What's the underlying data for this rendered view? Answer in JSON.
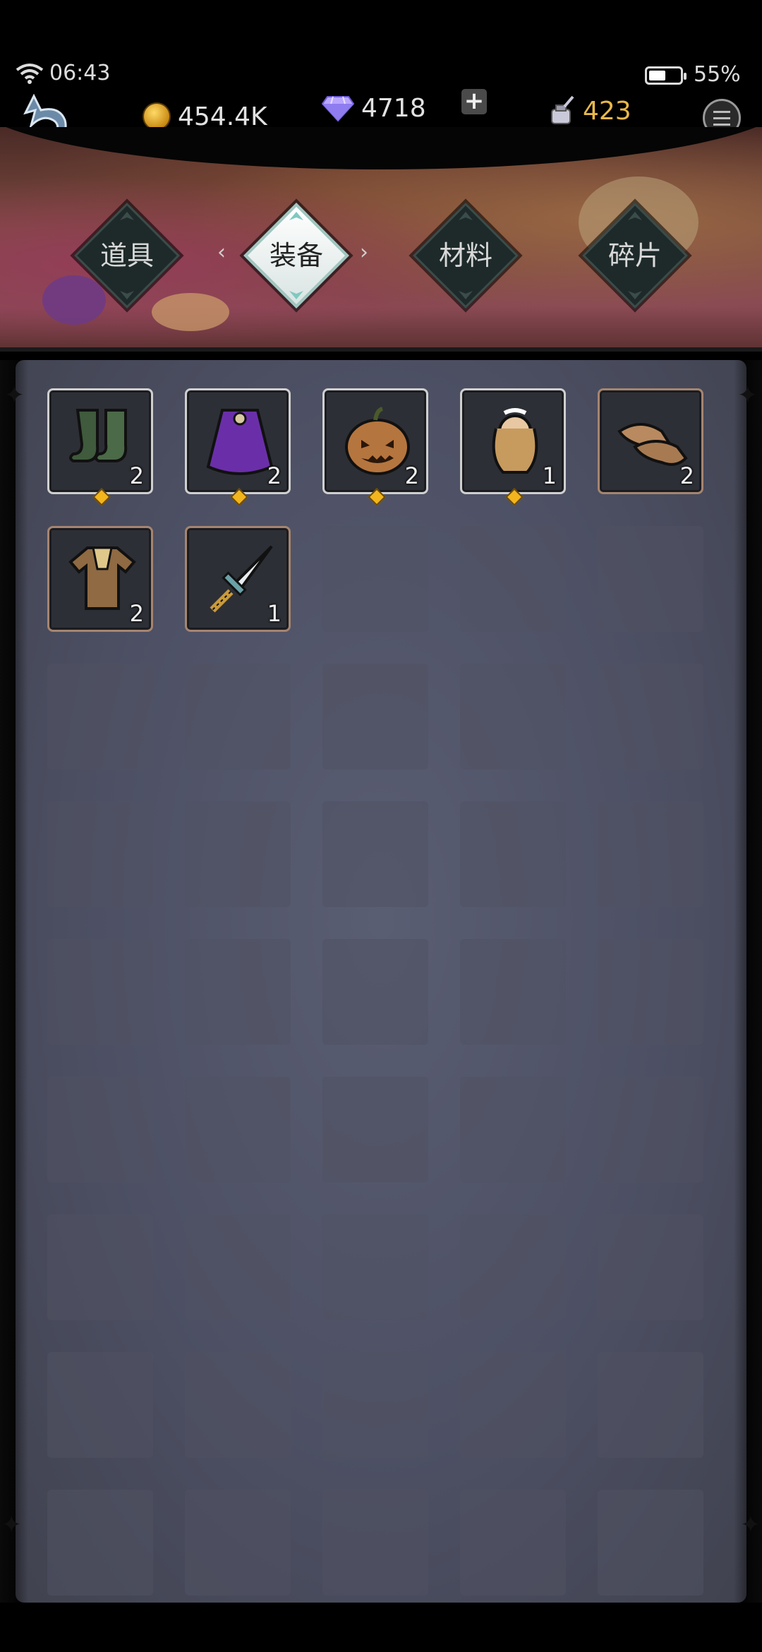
{
  "status_bar": {
    "time": "06:43",
    "battery_percent": "55%",
    "battery_level": 0.55
  },
  "currencies": {
    "gold": "454.4K",
    "diamond": "4718",
    "add_symbol": "+",
    "ink": "423"
  },
  "tabs": [
    {
      "label": "道具",
      "active": false
    },
    {
      "label": "装备",
      "active": true
    },
    {
      "label": "材料",
      "active": false
    },
    {
      "label": "碎片",
      "active": false
    }
  ],
  "inventory": {
    "items": [
      {
        "name": "boots",
        "icon": "boots-icon",
        "qty": "2",
        "frame": "silver",
        "marked": true
      },
      {
        "name": "cloak",
        "icon": "cloak-icon",
        "qty": "2",
        "frame": "silver",
        "marked": true
      },
      {
        "name": "pumpkin-head",
        "icon": "pumpkin-icon",
        "qty": "2",
        "frame": "silver",
        "marked": true
      },
      {
        "name": "maid-doll",
        "icon": "doll-icon",
        "qty": "1",
        "frame": "silver",
        "marked": true
      },
      {
        "name": "shoes",
        "icon": "shoes-icon",
        "qty": "2",
        "frame": "brown",
        "marked": false
      },
      {
        "name": "tunic",
        "icon": "tunic-icon",
        "qty": "2",
        "frame": "brown",
        "marked": false
      },
      {
        "name": "dagger",
        "icon": "dagger-icon",
        "qty": "1",
        "frame": "brown",
        "marked": false
      }
    ],
    "columns": 5,
    "rows": 9
  }
}
